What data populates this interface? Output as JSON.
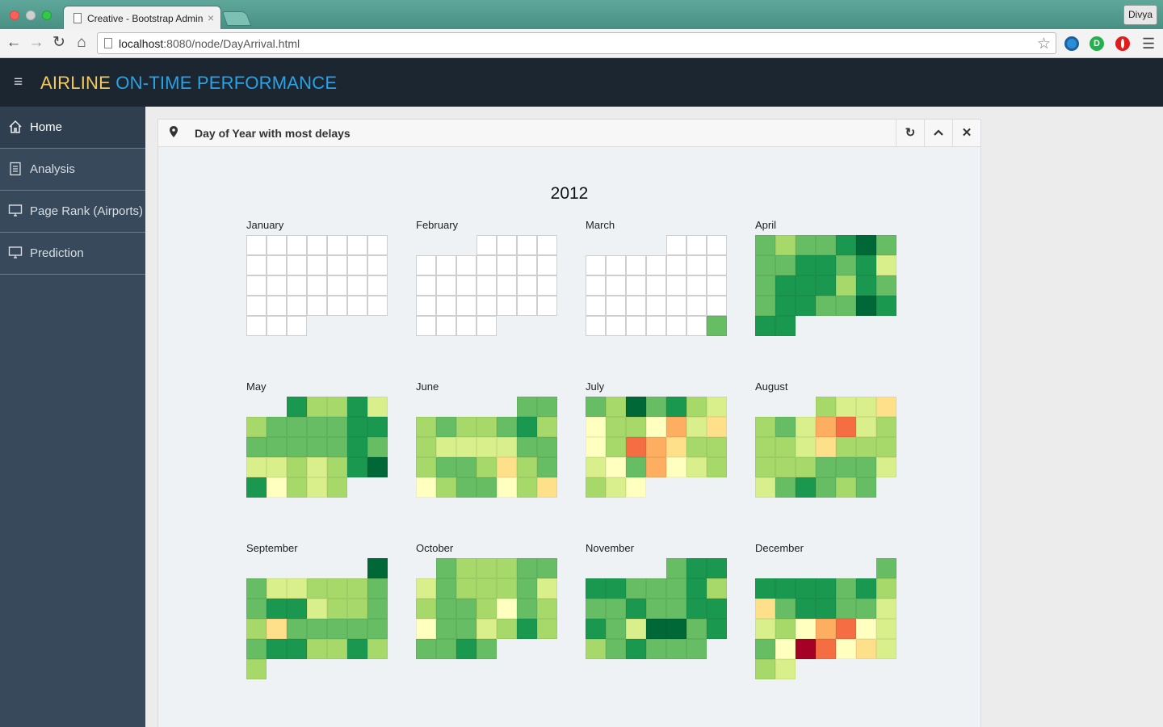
{
  "browser": {
    "tab_title": "Creative - Bootstrap Admin",
    "tab_close": "×",
    "profile_name": "Divya",
    "url_host": "localhost",
    "url_path": ":8080/node/DayArrival.html",
    "ext_letter": "D"
  },
  "app": {
    "brand_part1": "AIRLINE",
    "brand_part2": " ON-TIME PERFORMANCE",
    "menu_icon": "≡"
  },
  "sidebar": {
    "items": [
      {
        "label": "Home",
        "icon": "home-icon"
      },
      {
        "label": "Analysis",
        "icon": "document-icon"
      },
      {
        "label": "Page Rank (Airports)",
        "icon": "monitor-icon"
      },
      {
        "label": "Prediction",
        "icon": "monitor-icon"
      }
    ]
  },
  "panel": {
    "title": "Day of Year with most delays",
    "year": "2012"
  },
  "colors": {
    "palette": [
      "#ffffff",
      "#a50026",
      "#f46d43",
      "#fdae61",
      "#fee08b",
      "#ffffbf",
      "#d9ef8b",
      "#a6d96a",
      "#66bd63",
      "#1a9850",
      "#006837"
    ]
  },
  "calendar": {
    "months": [
      {
        "name": "January",
        "start": 0,
        "days": 31,
        "levels": []
      },
      {
        "name": "February",
        "start": 3,
        "days": 29,
        "levels": []
      },
      {
        "name": "March",
        "start": 4,
        "days": 31,
        "levels": [
          0,
          0,
          0,
          0,
          0,
          0,
          0,
          0,
          0,
          0,
          0,
          0,
          0,
          0,
          0,
          0,
          0,
          0,
          0,
          0,
          0,
          0,
          0,
          0,
          0,
          0,
          0,
          0,
          0,
          0,
          8
        ]
      },
      {
        "name": "April",
        "start": 0,
        "days": 30,
        "levels": [
          8,
          7,
          8,
          8,
          9,
          10,
          8,
          8,
          8,
          9,
          9,
          8,
          9,
          6,
          8,
          9,
          9,
          9,
          7,
          9,
          8,
          8,
          9,
          9,
          8,
          8,
          10,
          9,
          9,
          9
        ]
      },
      {
        "name": "May",
        "start": 2,
        "days": 31,
        "levels": [
          9,
          7,
          7,
          9,
          6,
          7,
          8,
          8,
          8,
          8,
          9,
          9,
          8,
          8,
          8,
          8,
          8,
          9,
          8,
          6,
          6,
          7,
          6,
          7,
          9,
          10,
          9,
          5,
          7,
          6,
          7
        ]
      },
      {
        "name": "June",
        "start": 5,
        "days": 30,
        "levels": [
          8,
          8,
          7,
          8,
          7,
          7,
          8,
          9,
          7,
          7,
          6,
          6,
          6,
          6,
          8,
          8,
          7,
          8,
          8,
          7,
          4,
          7,
          8,
          5,
          7,
          8,
          8,
          5,
          7,
          4
        ]
      },
      {
        "name": "July",
        "start": 0,
        "days": 31,
        "levels": [
          8,
          7,
          10,
          8,
          9,
          7,
          6,
          5,
          7,
          7,
          5,
          3,
          6,
          4,
          5,
          7,
          2,
          3,
          4,
          7,
          7,
          6,
          5,
          8,
          3,
          5,
          6,
          7,
          7,
          6,
          5
        ]
      },
      {
        "name": "August",
        "start": 3,
        "days": 31,
        "levels": [
          7,
          6,
          6,
          4,
          7,
          8,
          6,
          3,
          2,
          6,
          7,
          7,
          7,
          6,
          4,
          7,
          7,
          7,
          7,
          7,
          7,
          8,
          8,
          8,
          6,
          6,
          8,
          9,
          8,
          7,
          8
        ]
      },
      {
        "name": "September",
        "start": 6,
        "days": 30,
        "levels": [
          10,
          8,
          6,
          6,
          7,
          7,
          7,
          8,
          8,
          9,
          9,
          6,
          7,
          7,
          8,
          7,
          4,
          8,
          8,
          8,
          8,
          8,
          8,
          9,
          9,
          7,
          7,
          9,
          7,
          7
        ]
      },
      {
        "name": "October",
        "start": 1,
        "days": 31,
        "levels": [
          8,
          7,
          7,
          7,
          8,
          8,
          6,
          8,
          7,
          7,
          7,
          8,
          6,
          7,
          8,
          8,
          7,
          5,
          8,
          7,
          5,
          8,
          8,
          6,
          7,
          9,
          7,
          8,
          8,
          9,
          8
        ]
      },
      {
        "name": "November",
        "start": 4,
        "days": 30,
        "levels": [
          8,
          9,
          9,
          9,
          9,
          8,
          8,
          8,
          9,
          7,
          8,
          8,
          9,
          8,
          8,
          9,
          9,
          9,
          8,
          6,
          10,
          10,
          8,
          9,
          7,
          8,
          9,
          8,
          8,
          8
        ]
      },
      {
        "name": "December",
        "start": 6,
        "days": 31,
        "levels": [
          8,
          9,
          9,
          9,
          9,
          8,
          9,
          7,
          4,
          8,
          9,
          9,
          8,
          8,
          6,
          6,
          7,
          5,
          3,
          2,
          5,
          6,
          8,
          5,
          1,
          2,
          5,
          4,
          6,
          7,
          6
        ]
      }
    ]
  }
}
